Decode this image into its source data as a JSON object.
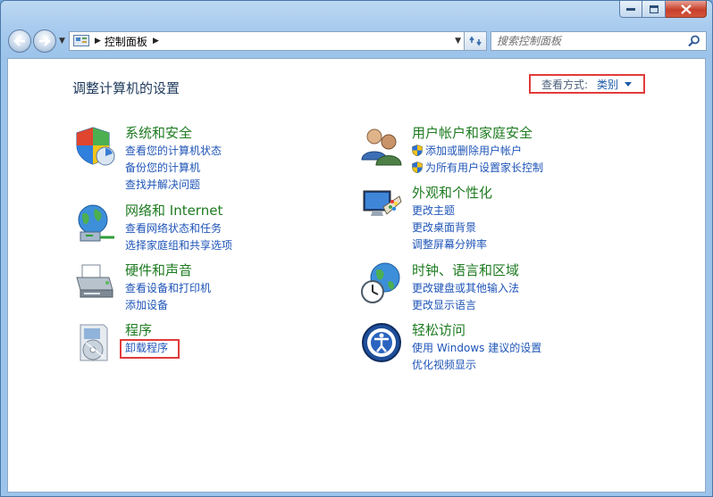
{
  "address": {
    "crumb": "控制面板"
  },
  "search": {
    "placeholder": "搜索控制面板"
  },
  "page_title": "调整计算机的设置",
  "view_by": {
    "label": "查看方式:",
    "value": "类别"
  },
  "categories_left": [
    {
      "title": "系统和安全",
      "icon": "security-shield-icon",
      "links": [
        "查看您的计算机状态",
        "备份您的计算机",
        "查找并解决问题"
      ]
    },
    {
      "title": "网络和 Internet",
      "icon": "network-globe-icon",
      "links": [
        "查看网络状态和任务",
        "选择家庭组和共享选项"
      ]
    },
    {
      "title": "硬件和声音",
      "icon": "printer-icon",
      "links": [
        "查看设备和打印机",
        "添加设备"
      ]
    },
    {
      "title": "程序",
      "icon": "programs-disc-icon",
      "links": [
        "卸载程序"
      ]
    }
  ],
  "categories_right": [
    {
      "title": "用户帐户和家庭安全",
      "icon": "users-icon",
      "links": [
        "添加或删除用户帐户",
        "为所有用户设置家长控制"
      ]
    },
    {
      "title": "外观和个性化",
      "icon": "monitor-palette-icon",
      "links": [
        "更改主题",
        "更改桌面背景",
        "调整屏幕分辨率"
      ]
    },
    {
      "title": "时钟、语言和区域",
      "icon": "clock-globe-icon",
      "links": [
        "更改键盘或其他输入法",
        "更改显示语言"
      ]
    },
    {
      "title": "轻松访问",
      "icon": "ease-of-access-icon",
      "links": [
        "使用 Windows 建议的设置",
        "优化视频显示"
      ]
    }
  ],
  "colors": {
    "heading": "#1e7b21",
    "link": "#1f55b8",
    "highlight": "#e23b3b",
    "title": "#1e395b"
  }
}
